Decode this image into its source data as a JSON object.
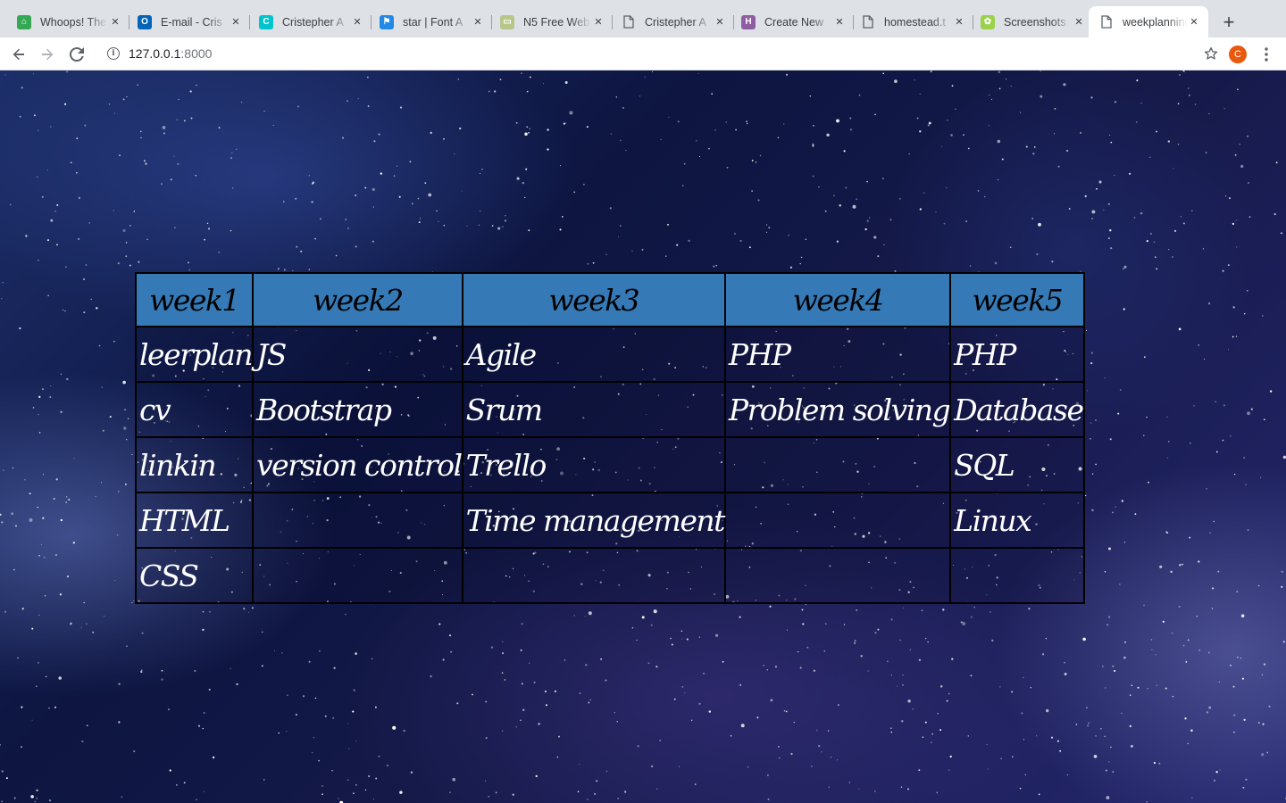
{
  "browser": {
    "tabs": [
      {
        "title": "Whoops! The",
        "favicon_color": "#34a853",
        "favicon_char": "⌂",
        "active": false
      },
      {
        "title": "E-mail - Cris",
        "favicon_color": "#0364b8",
        "favicon_char": "O",
        "active": false
      },
      {
        "title": "Cristepher A",
        "favicon_color": "#00c4cc",
        "favicon_char": "C",
        "active": false
      },
      {
        "title": "star | Font A",
        "favicon_color": "#228ae6",
        "favicon_char": "⚑",
        "active": false
      },
      {
        "title": "N5 Free Web",
        "favicon_color": "#b8c68a",
        "favicon_char": "▭",
        "active": false
      },
      {
        "title": "Cristepher A",
        "favicon_color": "",
        "favicon_char": "",
        "active": false
      },
      {
        "title": "Create New",
        "favicon_color": "#8e5ea2",
        "favicon_char": "H",
        "active": false
      },
      {
        "title": "homestead.t",
        "favicon_color": "",
        "favicon_char": "",
        "active": false
      },
      {
        "title": "Screenshots",
        "favicon_color": "#9bd24a",
        "favicon_char": "✿",
        "active": false
      },
      {
        "title": "weekplanning",
        "favicon_color": "",
        "favicon_char": "",
        "active": true
      }
    ],
    "url_host": "127.0.0.1",
    "url_port": ":8000",
    "avatar_letter": "C"
  },
  "table": {
    "headers": [
      "week1",
      "week2",
      "week3",
      "week4",
      "week5"
    ],
    "rows": [
      [
        "leerplan",
        "JS",
        "Agile",
        "PHP",
        "PHP"
      ],
      [
        "cv",
        "Bootstrap",
        "Srum",
        "Problem solving",
        "Database"
      ],
      [
        "linkin",
        "version control",
        "Trello",
        "",
        "SQL"
      ],
      [
        "HTML",
        "",
        "Time management",
        "",
        "Linux"
      ],
      [
        "CSS",
        "",
        "",
        "",
        ""
      ]
    ]
  },
  "colors": {
    "header_bg": "#357ab7",
    "cell_text": "#ffffff",
    "border": "#000000"
  }
}
